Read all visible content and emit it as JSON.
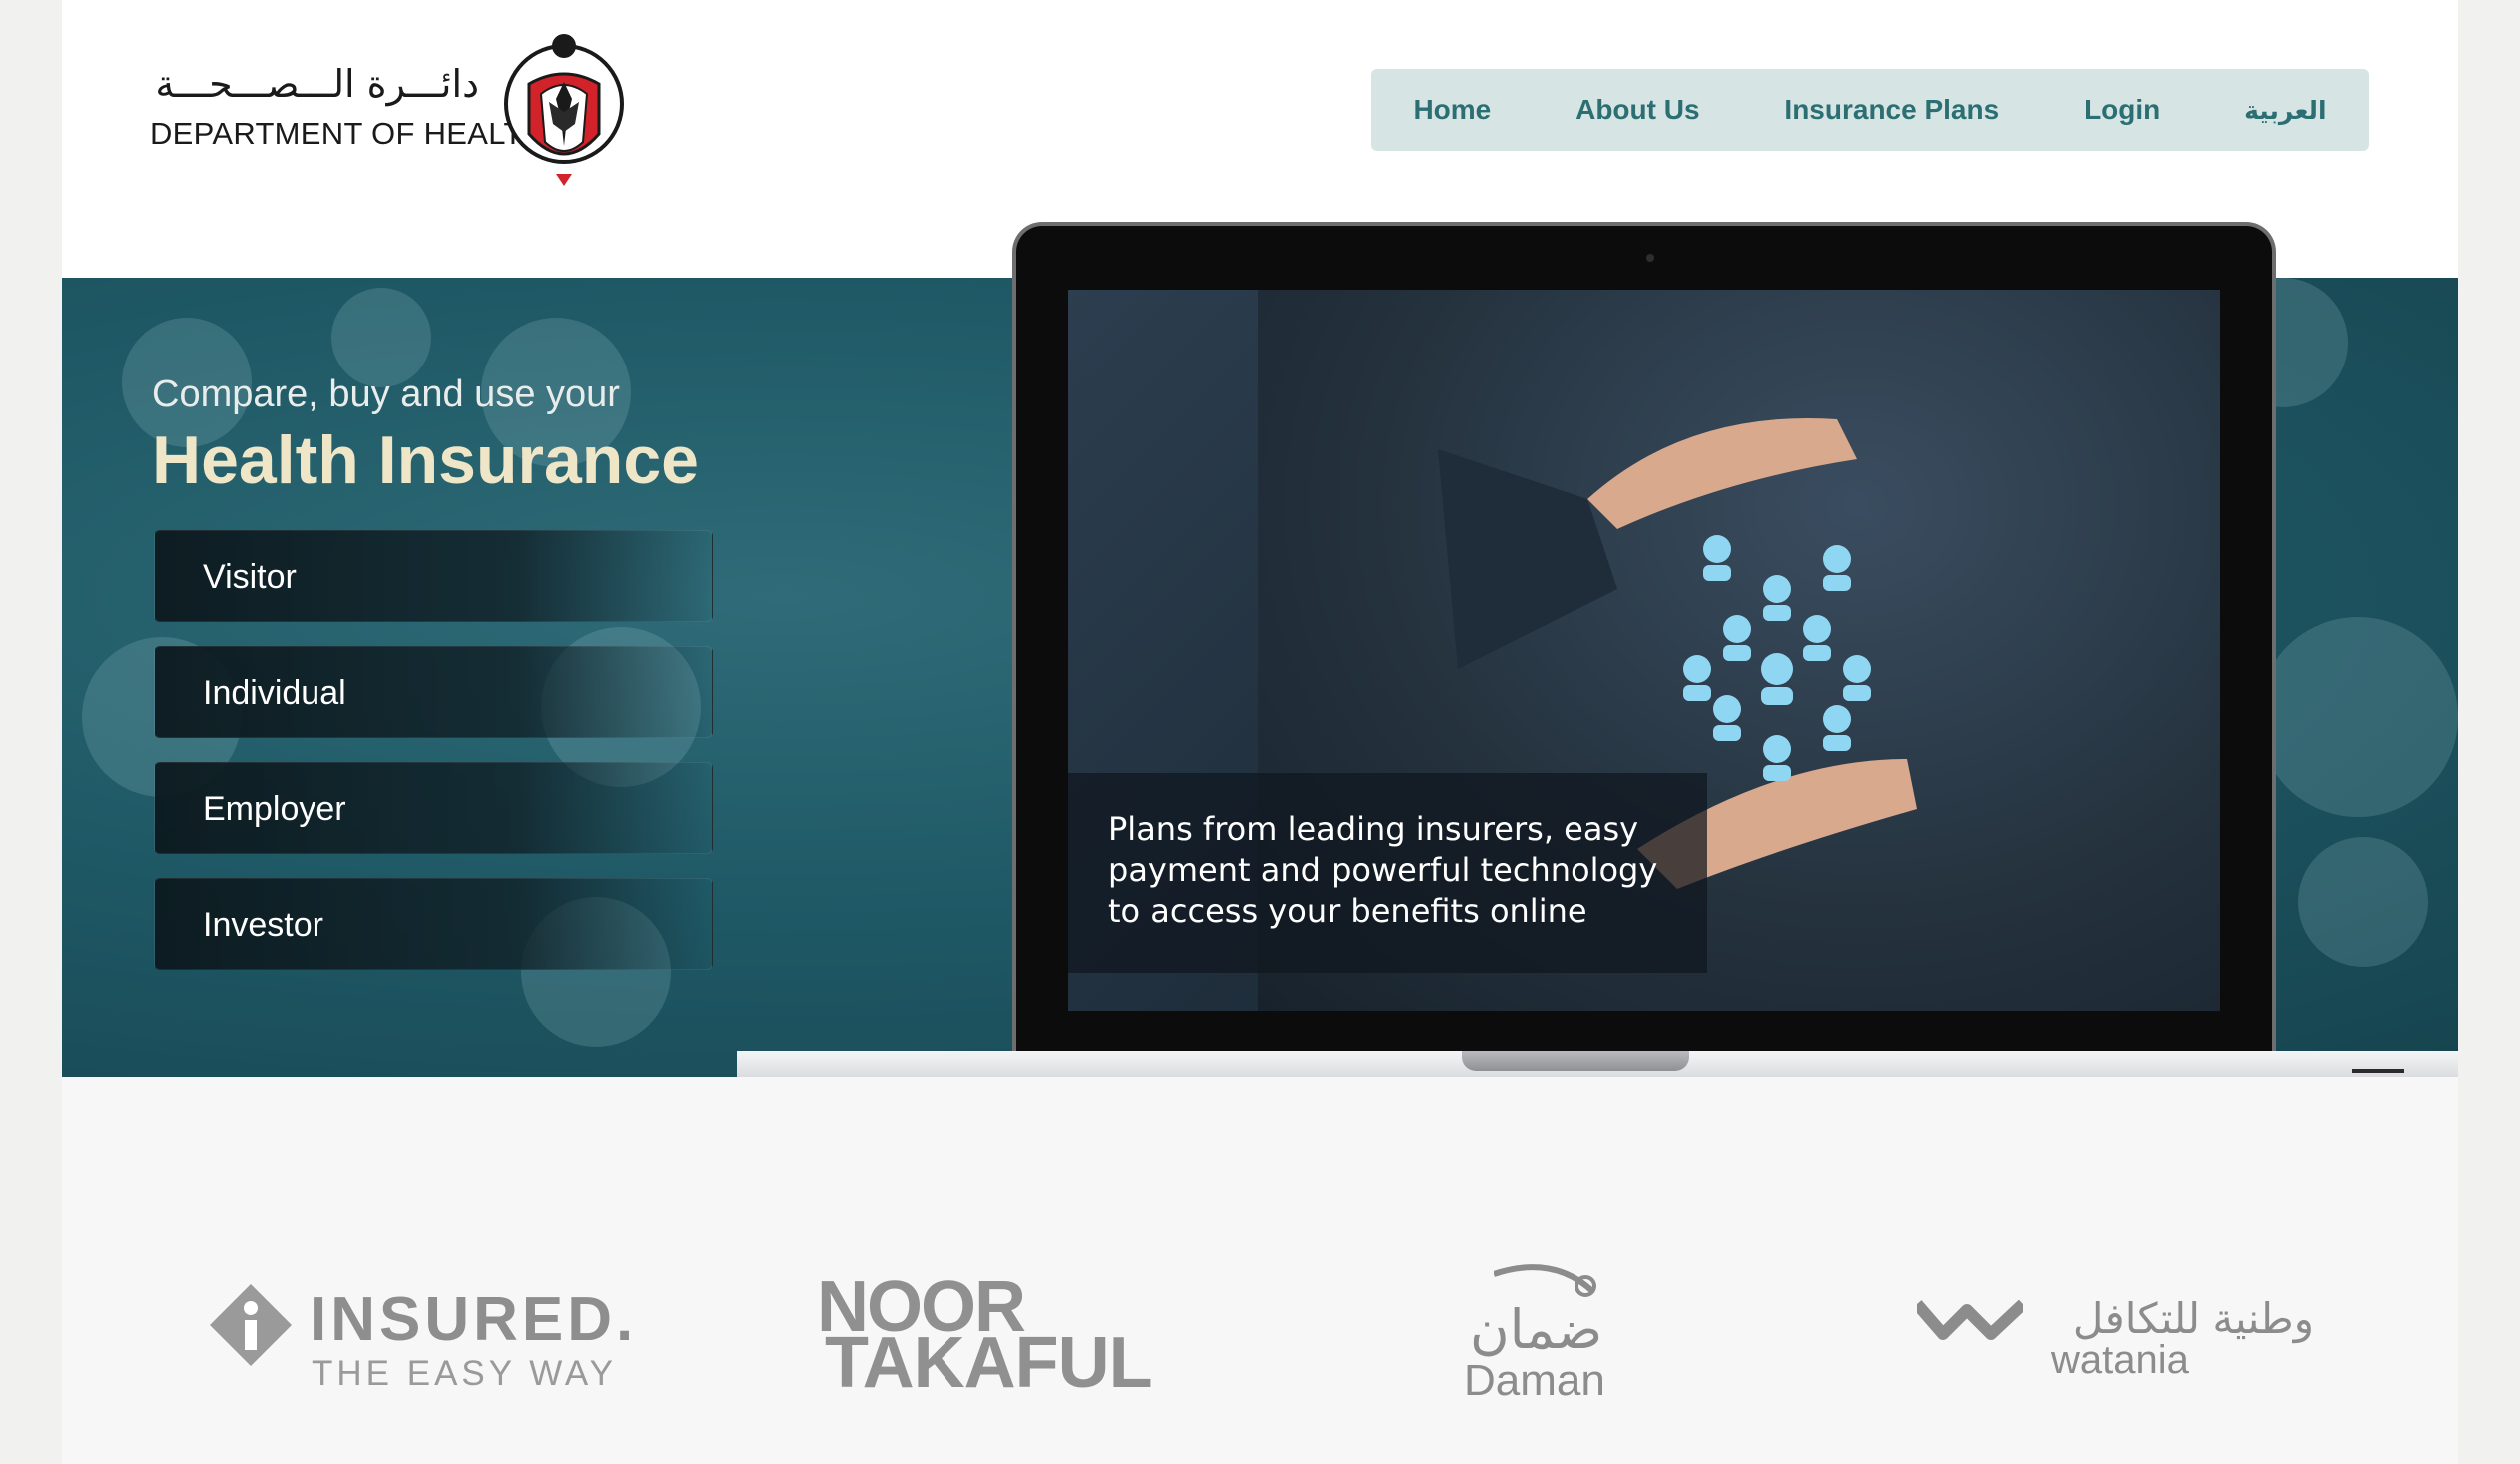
{
  "header": {
    "logo_arabic": "دائـــرة الـــصـــحـــة",
    "logo_english": "DEPARTMENT OF HEALTH",
    "nav": [
      "Home",
      "About Us",
      "Insurance Plans",
      "Login",
      "العربية"
    ]
  },
  "hero": {
    "subtitle": "Compare, buy and use your",
    "title": "Health Insurance",
    "categories": [
      "Visitor",
      "Individual",
      "Employer",
      "Investor"
    ],
    "screen_caption": "Plans from leading insurers, easy payment and powerful technology to access your benefits online"
  },
  "partners": {
    "insured_line1": "INSURED.",
    "insured_line2": "THE EASY WAY",
    "noor_line1": "NOOR",
    "noor_line2": "TAKAFUL",
    "daman_arabic": "ضمان",
    "daman_english": "Daman",
    "watania_arabic": "وطنية للتكافل",
    "watania_english": "watania"
  },
  "colors": {
    "nav_bg": "#d6e4e4",
    "nav_text": "#2b6f73",
    "hero_bg": "#1f5966",
    "hero_title": "#efe6c7"
  }
}
